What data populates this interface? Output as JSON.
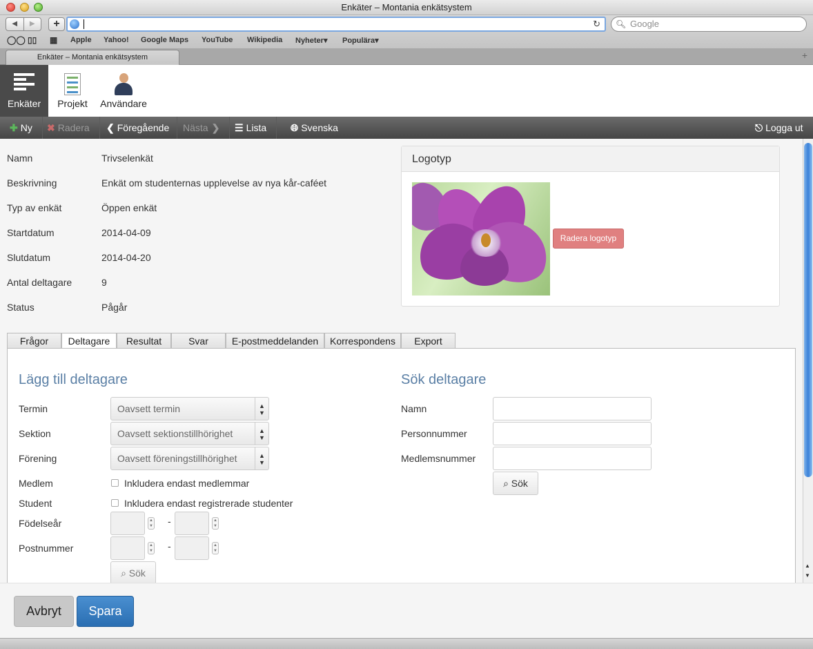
{
  "browser": {
    "window_title": "Enkäter – Montania enkätsystem",
    "tab_title": "Enkäter – Montania enkätsystem",
    "search_placeholder": "Google",
    "bookmarks": [
      "Apple",
      "Yahoo!",
      "Google Maps",
      "YouTube",
      "Wikipedia",
      "Nyheter▾",
      "Populära▾"
    ]
  },
  "modules": [
    {
      "label": "Enkäter",
      "icon": "list-bars-icon"
    },
    {
      "label": "Projekt",
      "icon": "document-chart-icon"
    },
    {
      "label": "Användare",
      "icon": "user-icon"
    }
  ],
  "actions": {
    "new": "Ny",
    "delete": "Radera",
    "previous": "Föregående",
    "next": "Nästa",
    "list": "Lista",
    "language": "Svenska",
    "logout": "Logga ut"
  },
  "survey": {
    "fields": [
      {
        "label": "Namn",
        "value": "Trivselenkät"
      },
      {
        "label": "Beskrivning",
        "value": "Enkät om studenternas upplevelse av nya kår-caféet"
      },
      {
        "label": "Typ av enkät",
        "value": "Öppen enkät"
      },
      {
        "label": "Startdatum",
        "value": "2014-04-09"
      },
      {
        "label": "Slutdatum",
        "value": "2014-04-20"
      },
      {
        "label": "Antal deltagare",
        "value": "9"
      },
      {
        "label": "Status",
        "value": "Pågår"
      }
    ]
  },
  "logo_panel": {
    "title": "Logotyp",
    "delete_button": "Radera logotyp"
  },
  "tabs": [
    "Frågor",
    "Deltagare",
    "Resultat",
    "Svar",
    "E-postmeddelanden",
    "Korrespondens",
    "Export"
  ],
  "add_participants": {
    "title": "Lägg till deltagare",
    "term_label": "Termin",
    "term_value": "Oavsett termin",
    "section_label": "Sektion",
    "section_value": "Oavsett sektionstillhörighet",
    "association_label": "Förening",
    "association_value": "Oavsett föreningstillhörighet",
    "member_label": "Medlem",
    "member_checkbox": "Inkludera endast medlemmar",
    "student_label": "Student",
    "student_checkbox": "Inkludera endast registrerade studenter",
    "birthyear_label": "Födelseår",
    "postcode_label": "Postnummer",
    "range_separator": "-",
    "search_button": "Sök"
  },
  "search_participants": {
    "title": "Sök deltagare",
    "name_label": "Namn",
    "ssn_label": "Personnummer",
    "member_number_label": "Medlemsnummer",
    "search_button": "Sök"
  },
  "footer": {
    "cancel": "Avbryt",
    "save": "Spara"
  },
  "colors": {
    "accent_blue": "#2a6eb2",
    "heading_blue": "#5a7fa5",
    "danger_red": "#e08080",
    "new_green": "#5cb85c"
  }
}
